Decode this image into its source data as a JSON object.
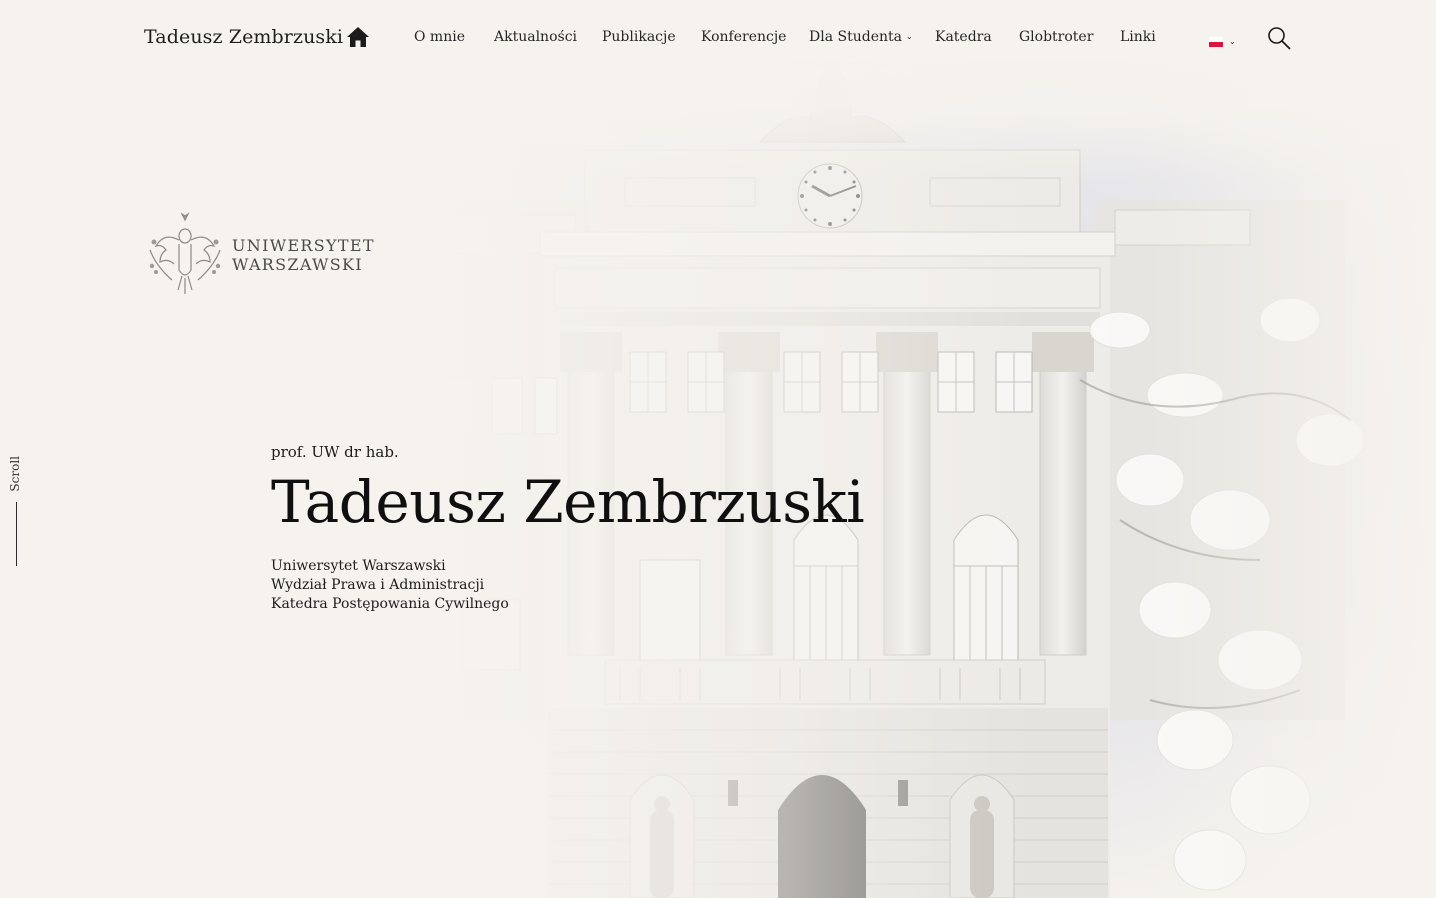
{
  "header": {
    "site_title": "Tadeusz Zembrzuski",
    "nav": [
      {
        "label": "O mnie"
      },
      {
        "label": "Aktualności"
      },
      {
        "label": "Publikacje"
      },
      {
        "label": "Konferencje"
      },
      {
        "label": "Dla Studenta"
      },
      {
        "label": "Katedra"
      },
      {
        "label": "Globtroter"
      },
      {
        "label": "Linki"
      }
    ],
    "dropdown_chevron": "⌄",
    "lang_chevron": "⌄",
    "icons": {
      "home": "home-icon",
      "search": "search-icon",
      "language": "poland-flag-icon"
    }
  },
  "logo": {
    "line1": "UNIWERSYTET",
    "line2": "WARSZAWSKI"
  },
  "hero": {
    "degree": "prof. UW dr hab.",
    "name": "Tadeusz Zembrzuski",
    "affiliation": [
      "Uniwersytet Warszawski",
      "Wydział Prawa i Administracji",
      "Katedra Postępowania Cywilnego"
    ]
  },
  "scroll": {
    "label": "Scroll"
  },
  "colors": {
    "background": "#f6f3ee",
    "text": "#1b1b1b",
    "flag_red": "#dc143c",
    "flag_white": "#ffffff"
  }
}
